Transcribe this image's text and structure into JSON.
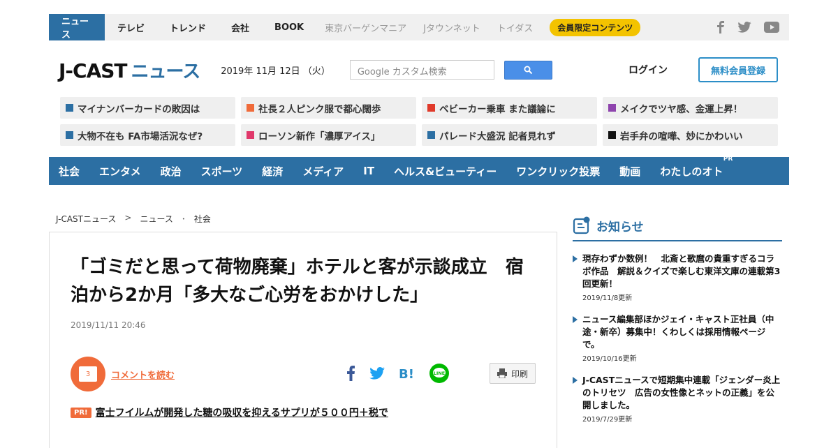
{
  "topnav": {
    "items": [
      "ニュース",
      "テレビ",
      "トレンド",
      "会社",
      "BOOK"
    ],
    "external": [
      "東京バーゲンマニア",
      "Jタウンネット",
      "トイダス"
    ],
    "member_badge": "会員限定コンテンツ",
    "social_icons": [
      "facebook-icon",
      "twitter-icon",
      "youtube-icon"
    ]
  },
  "header": {
    "logo_main": "J-CAST",
    "logo_sub": "ニュース",
    "date": "2019年 11月 12日 （火）",
    "search_placeholder": "Google カスタム検索",
    "login": "ログイン",
    "register": "無料会員登録"
  },
  "trending": [
    {
      "label": "マイナンバーカードの敗因は",
      "color": "#2c6fa3"
    },
    {
      "label": "社長２人ピンク服で都心闊歩",
      "color": "#f06b3a"
    },
    {
      "label": "ベビーカー乗車 また議論に",
      "color": "#e03a2a"
    },
    {
      "label": "メイクでツヤ感、金運上昇！",
      "color": "#8e44ad"
    },
    {
      "label": "大物不在も FA市場活況なぜ?",
      "color": "#2c6fa3"
    },
    {
      "label": "ローソン新作「濃厚アイス」",
      "color": "#e0386a"
    },
    {
      "label": "パレード大盛況 記者見れず",
      "color": "#2c6fa3"
    },
    {
      "label": "岩手弁の喧嘩、妙にかわいい",
      "color": "#111111"
    }
  ],
  "categories": [
    "社会",
    "エンタメ",
    "政治",
    "スポーツ",
    "経済",
    "メディア",
    "IT",
    "ヘルス&ビューティー",
    "ワンクリック投票",
    "動画",
    "わたしのオト"
  ],
  "category_pr": "PR",
  "breadcrumb": {
    "home": "J-CASTニュース",
    "sep1": ">",
    "section": "ニュース",
    "sep2": "･",
    "category": "社会"
  },
  "article": {
    "title": "「ゴミだと思って荷物廃棄」ホテルと客が示談成立　宿泊から2か月「多大なご心労をおかけした」",
    "date": "2019/11/11 20:46",
    "comment_count": "3",
    "comment_link": "コメントを読む",
    "print_label": "印刷",
    "pr_badge": "PR!",
    "pr_text": "富士フイルムが開発した糖の吸収を抑えるサプリが５００円＋税で"
  },
  "notices": {
    "title": "お知らせ",
    "items": [
      {
        "text": "現存わずか数例！　北斎と歌麿の貴重すぎるコラボ作品　解説＆クイズで楽しむ東洋文庫の連載第3回更新！",
        "date": "2019/11/8更新"
      },
      {
        "text": "ニュース編集部ほかジェイ・キャスト正社員（中途・新卒）募集中！くわしくは採用情報ページで。",
        "date": "2019/10/16更新"
      },
      {
        "text": "J-CASTニュースで短期集中連載「ジェンダー炎上のトリセツ　広告の女性像とネットの正義」を公開しました。",
        "date": "2019/7/29更新"
      }
    ]
  }
}
